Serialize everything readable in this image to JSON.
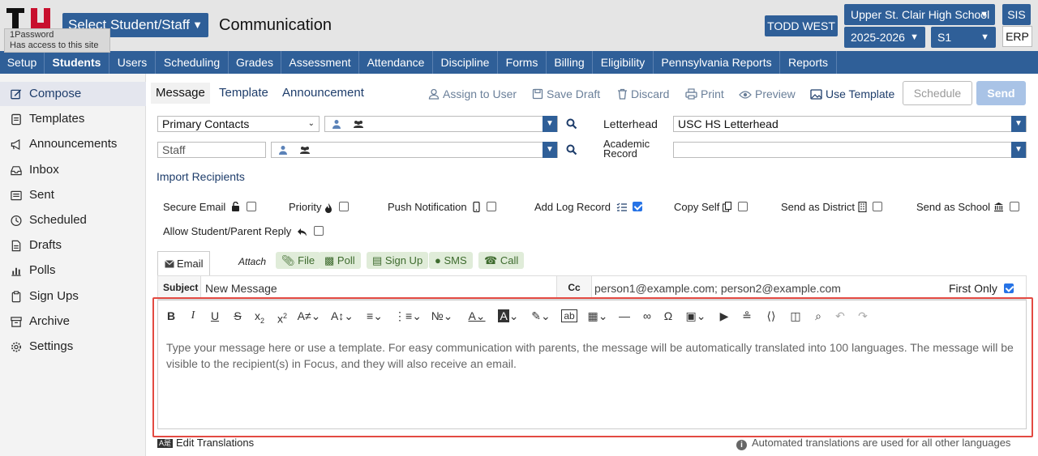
{
  "header": {
    "tooltip_title": "1Password",
    "tooltip_sub": "Has access to this site",
    "select_label": "Select Student/Staff",
    "page_title": "Communication",
    "user_name": "TODD WEST",
    "school": "Upper St. Clair High School",
    "year": "2025-2026",
    "term": "S1",
    "sis_label": "SIS",
    "erp_label": "ERP"
  },
  "nav": {
    "items": [
      "Setup",
      "Students",
      "Users",
      "Scheduling",
      "Grades",
      "Assessment",
      "Attendance",
      "Discipline",
      "Forms",
      "Billing",
      "Eligibility",
      "Pennsylvania Reports",
      "Reports"
    ],
    "active": "Students"
  },
  "sidebar": {
    "items": [
      {
        "label": "Compose",
        "icon": "compose-icon"
      },
      {
        "label": "Templates",
        "icon": "templates-icon"
      },
      {
        "label": "Announcements",
        "icon": "megaphone-icon"
      },
      {
        "label": "Inbox",
        "icon": "inbox-icon"
      },
      {
        "label": "Sent",
        "icon": "sent-icon"
      },
      {
        "label": "Scheduled",
        "icon": "clock-icon"
      },
      {
        "label": "Drafts",
        "icon": "drafts-icon"
      },
      {
        "label": "Polls",
        "icon": "polls-icon"
      },
      {
        "label": "Sign Ups",
        "icon": "signups-icon"
      },
      {
        "label": "Archive",
        "icon": "archive-icon"
      },
      {
        "label": "Settings",
        "icon": "gear-icon"
      }
    ],
    "active": "Compose"
  },
  "tabs": {
    "message": "Message",
    "template": "Template",
    "announcement": "Announcement"
  },
  "toolbar": {
    "assign": "Assign to User",
    "save_draft": "Save Draft",
    "discard": "Discard",
    "print": "Print",
    "preview": "Preview",
    "use_template": "Use Template",
    "schedule": "Schedule",
    "send": "Send"
  },
  "recipients": {
    "primary_contacts": "Primary Contacts",
    "staff_placeholder": "Staff",
    "letterhead_label": "Letterhead",
    "letterhead_value": "USC HS Letterhead",
    "academic_record_label": "Academic Record",
    "academic_record_value": "",
    "import_link": "Import Recipients"
  },
  "options": {
    "secure_email": "Secure Email",
    "priority": "Priority",
    "push_notification": "Push Notification",
    "add_log_record": "Add Log Record",
    "copy_self": "Copy Self",
    "send_as_district": "Send as District",
    "send_as_school": "Send as School",
    "allow_reply": "Allow Student/Parent Reply",
    "add_log_record_checked": true,
    "first_only_checked": true
  },
  "compose": {
    "email_tab": "Email",
    "attach_label": "Attach",
    "chips": [
      "File",
      "Poll",
      "Sign Up",
      "SMS",
      "Call"
    ],
    "subject_label": "Subject",
    "subject_value": "New Message",
    "cc_label": "Cc",
    "cc_value": "person1@example.com; person2@example.com",
    "first_only": "First Only",
    "editor_placeholder": "Type your message here or use a template. For easy communication with parents, the message will be automatically translated into 100 languages. The message will be visible to the recipient(s) in Focus, and they will also receive an email."
  },
  "footer": {
    "edit_translations": "Edit Translations",
    "translation_note": "Automated translations are used for all other languages"
  },
  "colors": {
    "brand_blue": "#2f5f98",
    "send_disabled": "#a9c3e6",
    "highlight_red": "#e34a42",
    "chip_green": "#e0ecd9"
  }
}
